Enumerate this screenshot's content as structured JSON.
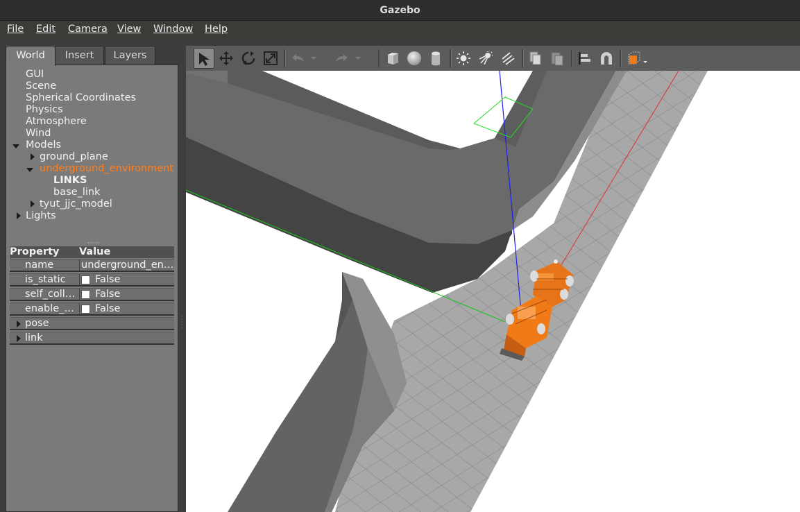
{
  "window": {
    "title": "Gazebo"
  },
  "menu": [
    {
      "label": "File",
      "underline": "F"
    },
    {
      "label": "Edit",
      "underline": "E"
    },
    {
      "label": "Camera",
      "underline": "C"
    },
    {
      "label": "View",
      "underline": "V"
    },
    {
      "label": "Window",
      "underline": "W"
    },
    {
      "label": "Help",
      "underline": "H"
    }
  ],
  "tabs": {
    "world": "World",
    "insert": "Insert",
    "layers": "Layers"
  },
  "tree": {
    "gui": "GUI",
    "scene": "Scene",
    "spherical": "Spherical Coordinates",
    "physics": "Physics",
    "atmosphere": "Atmosphere",
    "wind": "Wind",
    "models": "Models",
    "ground_plane": "ground_plane",
    "underground_environment": "underground_environment",
    "links": "LINKS",
    "base_link": "base_link",
    "tyut_model": "tyut_jjc_model",
    "lights": "Lights"
  },
  "properties": {
    "header_property": "Property",
    "header_value": "Value",
    "name_key": "name",
    "name_value": "underground_en…",
    "is_static_key": "is_static",
    "is_static_value": "False",
    "self_coll_key": "self_coll…",
    "self_coll_value": "False",
    "enable_key": "enable_…",
    "enable_value": "False",
    "pose": "pose",
    "link": "link"
  },
  "toolbar": {
    "tools": [
      "select-mode",
      "translate-mode",
      "rotate-mode",
      "scale-mode",
      "undo",
      "redo",
      "box-shape",
      "sphere-shape",
      "cylinder-shape",
      "point-light",
      "spot-light",
      "directional-light",
      "copy",
      "paste",
      "align",
      "snap",
      "view-angle"
    ]
  },
  "colors": {
    "selected": "#ff7f1c",
    "model": "#f07a18",
    "ground": "#a8a8a8",
    "wall": "#6e6e6e"
  }
}
